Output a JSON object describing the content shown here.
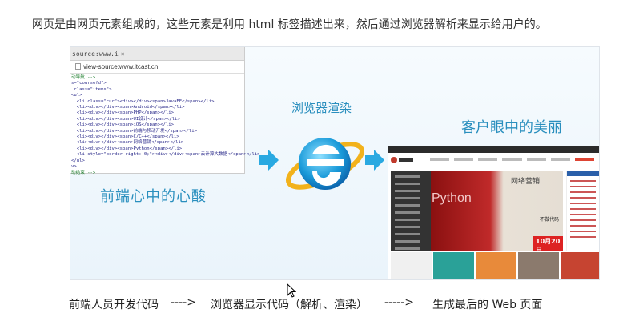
{
  "intro": "网页是由网页元素组成的，这些元素是利用 html 标签描述出来，然后通过浏览器解析来显示给用户的。",
  "source_window": {
    "tab_title": "source:www.i",
    "tab_close": "×",
    "address": "view-source:www.itcast.cn",
    "code_lines": [
      {
        "text": "动导航 -->",
        "comment": true
      },
      {
        "text": "s=\"coursefd\">",
        "comment": false
      },
      {
        "text": " class=\"items\">",
        "comment": false
      },
      {
        "text": "<ul>",
        "comment": false
      },
      {
        "text": "  <li class=\"cur\"><div></div><span>JavaEE</span></li>",
        "comment": false
      },
      {
        "text": "  <li><div></div><span>Android</span></li>",
        "comment": false
      },
      {
        "text": "  <li><div></div><span>PHP</span></li>",
        "comment": false
      },
      {
        "text": "  <li><div></div><span>UI设计</span></li>",
        "comment": false
      },
      {
        "text": "  <li><div></div><span>iOS</span></li>",
        "comment": false
      },
      {
        "text": "  <li><div></div><span>前端与移动开发</span></li>",
        "comment": false
      },
      {
        "text": "  <li><div></div><span>C/C++</span></li>",
        "comment": false
      },
      {
        "text": "  <li><div></div><span>网络营销</span></li>",
        "comment": false
      },
      {
        "text": "  <li><div></div><span>Python</span></li>",
        "comment": false
      },
      {
        "text": "  <li style=\"border-right: 0;\"><div></div><span>云计算大数据</span></li>",
        "comment": false
      },
      {
        "text": "</ul>",
        "comment": false
      },
      {
        "text": "v>",
        "comment": false
      },
      {
        "text": "",
        "comment": false
      },
      {
        "text": "动结束 -->",
        "comment": true
      }
    ]
  },
  "labels": {
    "source": "前端心中的心酸",
    "render": "浏览器渲染",
    "eye": "客户眼中的美丽"
  },
  "site_preview": {
    "banner_text": "Python",
    "banner_right_text": "网络营销",
    "banner_right_sub": "不做代码",
    "date_badge": "10月20日"
  },
  "caption": {
    "step1": "前端人员开发代码",
    "arrow1": "---->",
    "step2": "浏览器显示代码（解析、渲染）",
    "arrow2": "----->",
    "step3": "生成最后的 Web 页面"
  },
  "colors": {
    "accent": "#2a8fbe",
    "arrow": "#29a9e1"
  }
}
